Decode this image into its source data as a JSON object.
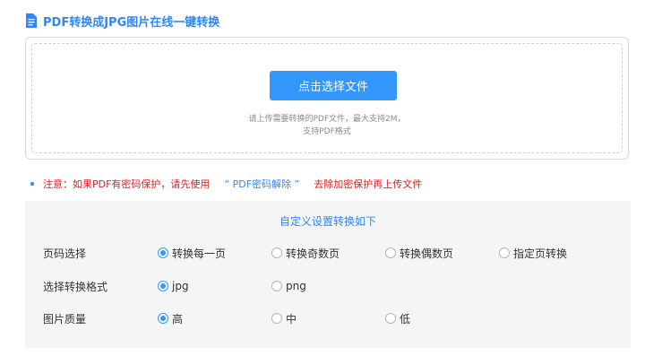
{
  "title": "PDF转换成JPG图片在线一键转换",
  "upload": {
    "button_label": "点击选择文件",
    "hint_line1": "请上传需要转换的PDF文件，最大支持2M，",
    "hint_line2": "支持PDF格式"
  },
  "notice": {
    "prefix": "注意：如果PDF有密码保护，请先使用",
    "link": "“ PDF密码解除 ”",
    "suffix": "去除加密保护再上传文件"
  },
  "settings": {
    "title": "自定义设置转换如下",
    "rows": [
      {
        "label": "页码选择",
        "options": [
          "转换每一页",
          "转换奇数页",
          "转换偶数页",
          "指定页转换"
        ],
        "selected": 0
      },
      {
        "label": "选择转换格式",
        "options": [
          "jpg",
          "png"
        ],
        "selected": 0
      },
      {
        "label": "图片质量",
        "options": [
          "高",
          "中",
          "低"
        ],
        "selected": 0
      }
    ]
  },
  "colors": {
    "accent": "#3296fa",
    "warning": "#e02020",
    "panel_bg": "#f5f5f5"
  }
}
